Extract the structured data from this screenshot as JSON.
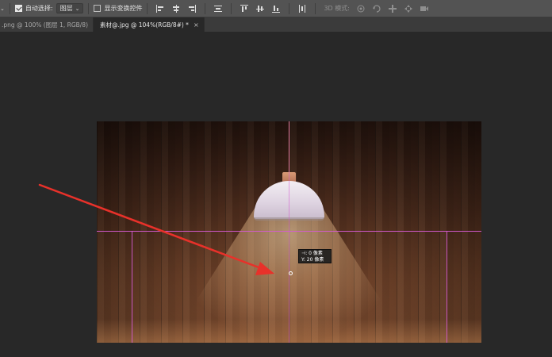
{
  "options_bar": {
    "auto_select_label": "自动选择:",
    "auto_select_checked": true,
    "auto_select_target": "图层",
    "show_transform_label": "显示变换控件",
    "show_transform_checked": false,
    "mode_3d_label": "3D 模式:"
  },
  "tabs": [
    {
      "label": ".png @ 100% (图层 1, RGB/8)",
      "active": false
    },
    {
      "label": "素材@.jpg @ 104%(RGB/8#) *",
      "active": true,
      "close": "×"
    }
  ],
  "tooltip": {
    "line1": "⊣:  0 像素",
    "line2": "Y:  20 像素"
  },
  "colors": {
    "guide": "#d55bd2",
    "arrow": "#e8312a",
    "toolbar_bg": "#535353",
    "canvas_bg": "#282828"
  },
  "icons": {
    "align_left": "align-left-icon",
    "align_center": "align-center-icon",
    "align_right": "align-right-icon",
    "distribute": "distribute-icon",
    "align_top": "align-top-icon",
    "align_middle": "align-middle-icon",
    "align_bottom": "align-bottom-icon",
    "orbit_3d": "orbit-3d-icon",
    "roll_3d": "roll-3d-icon",
    "pan_3d": "pan-3d-icon",
    "slide_3d": "slide-3d-icon",
    "video_3d": "video-3d-icon"
  }
}
